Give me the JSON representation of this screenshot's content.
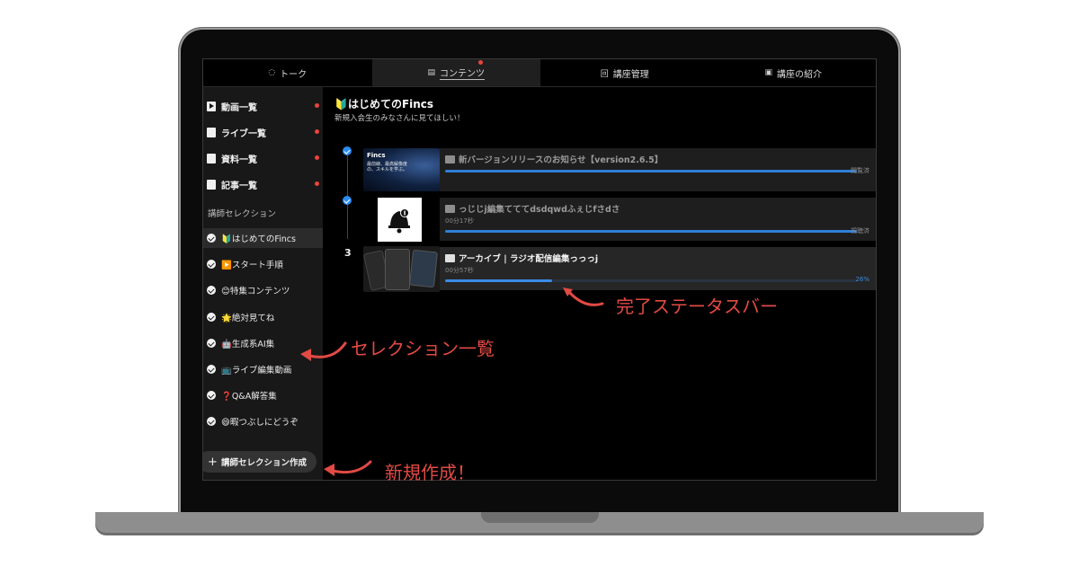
{
  "tabs": [
    {
      "icon": "chat-icon",
      "label": "トーク",
      "active": false
    },
    {
      "icon": "document-icon",
      "label": "コンテンツ",
      "active": true
    },
    {
      "icon": "course-manage-icon",
      "label": "講座管理",
      "active": false
    },
    {
      "icon": "book-icon",
      "label": "講座の紹介",
      "active": false
    }
  ],
  "sidebar": {
    "items": [
      {
        "label": "動画一覧",
        "icon": "play-icon",
        "notification": true
      },
      {
        "label": "ライブ一覧",
        "icon": "live-icon",
        "notification": true
      },
      {
        "label": "資料一覧",
        "icon": "file-icon",
        "notification": true
      },
      {
        "label": "記事一覧",
        "icon": "article-icon",
        "notification": true
      }
    ],
    "selection_heading": "講師セレクション",
    "selections": [
      {
        "label": "🔰はじめてのFincs",
        "active": true
      },
      {
        "label": "▶️スタート手順",
        "active": false
      },
      {
        "label": "😊特集コンテンツ",
        "active": false
      },
      {
        "label": "🌟絶対見てね",
        "active": false
      },
      {
        "label": "🤖生成系AI集",
        "active": false
      },
      {
        "label": "📺ライブ編集動画",
        "active": false
      },
      {
        "label": "❓Q&A解答集",
        "active": false
      },
      {
        "label": "😄暇つぶしにどうぞ",
        "active": false
      }
    ],
    "new_button": "講師セレクション作成"
  },
  "main": {
    "title": "🔰はじめてのFincs",
    "subtitle": "新規入会生のみなさんに見てほしい！",
    "rows": [
      {
        "index": "",
        "done": true,
        "thumb_text": "Fincs",
        "thumb_caption": "最前線、最高解像度の、スキルを学ぶ。",
        "title": "新バージョンリリースのお知らせ【version2.6.5】",
        "duration": "",
        "progress": 1.0,
        "status": "閲覧済"
      },
      {
        "index": "",
        "done": true,
        "thumb_text": "",
        "title": "っじじj編集てててdsdqwdふぇじfさdさ",
        "duration": "00分17秒",
        "progress": 1.0,
        "status": "視聴済"
      },
      {
        "index": "3",
        "done": false,
        "thumb_text": "",
        "title": "アーカイブ | ラジオ配信編集っっっj",
        "duration": "00分57秒",
        "progress": 0.26,
        "status": "26%"
      }
    ]
  },
  "annotations": {
    "status_bar": "完了ステータスバー",
    "selection_list": "セレクション一覧",
    "new_create": "新規作成！"
  },
  "colors": {
    "accent": "#2d8bf0",
    "notify": "#e8453c",
    "annotation": "#e24a44"
  }
}
